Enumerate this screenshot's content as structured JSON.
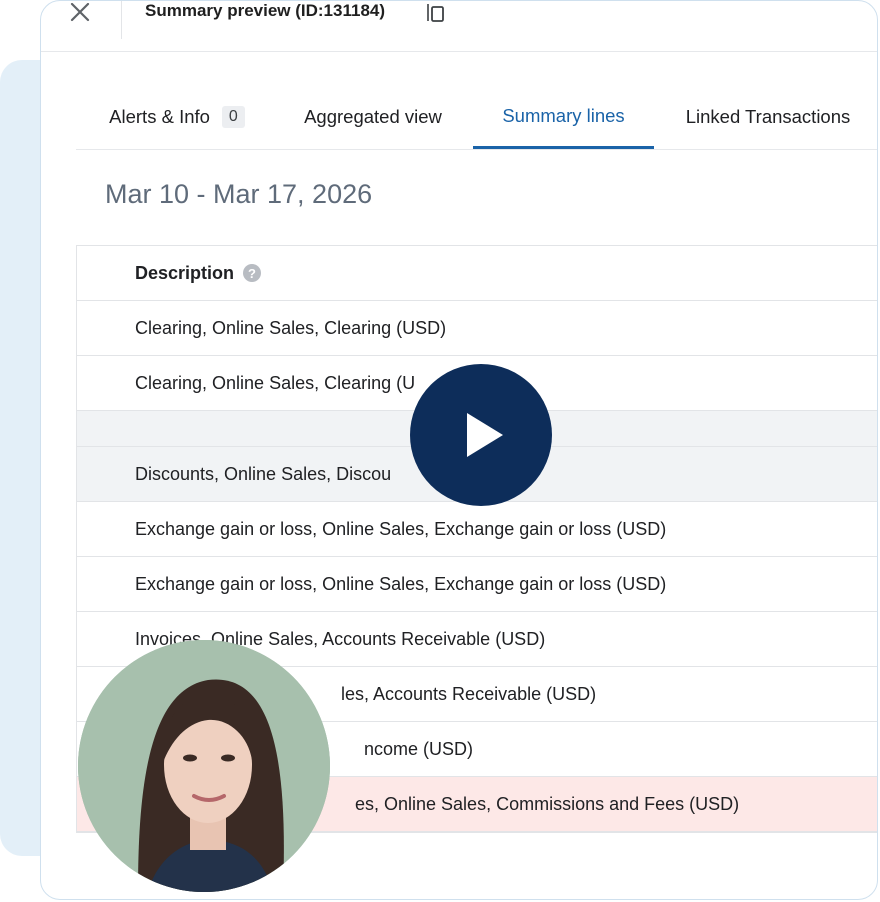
{
  "header": {
    "title": "Summary preview (ID:131184)",
    "close_icon": "close-icon",
    "copy_icon": "copy-icon"
  },
  "tabs": [
    {
      "label": "Alerts & Info",
      "badge": "0",
      "active": false
    },
    {
      "label": "Aggregated view",
      "active": false
    },
    {
      "label": "Summary lines",
      "active": true
    },
    {
      "label": "Linked Transactions",
      "active": false
    }
  ],
  "date_range": "Mar 10 - Mar 17, 2026",
  "table": {
    "header": "Description",
    "help_icon": "?",
    "rows": [
      "Clearing, Online Sales, Clearing (USD)",
      "Clearing, Online Sales, Clearing (U",
      "",
      "Discounts, Online Sales, Discou",
      "Exchange gain or loss, Online Sales, Exchange gain or loss (USD)",
      "Exchange gain or loss, Online Sales, Exchange gain or loss (USD)",
      "Invoices, Online Sales, Accounts Receivable (USD)",
      "les, Accounts Receivable (USD)",
      "ncome (USD)",
      "es, Online Sales, Commissions and Fees (USD)"
    ]
  },
  "video": {
    "play_icon": "play-icon"
  },
  "colors": {
    "accent": "#1a63a8",
    "play_button": "#0d2d5a",
    "highlight_row": "#fde8e7",
    "gray_row": "#f1f3f5",
    "side_panel": "#e3eff8"
  }
}
